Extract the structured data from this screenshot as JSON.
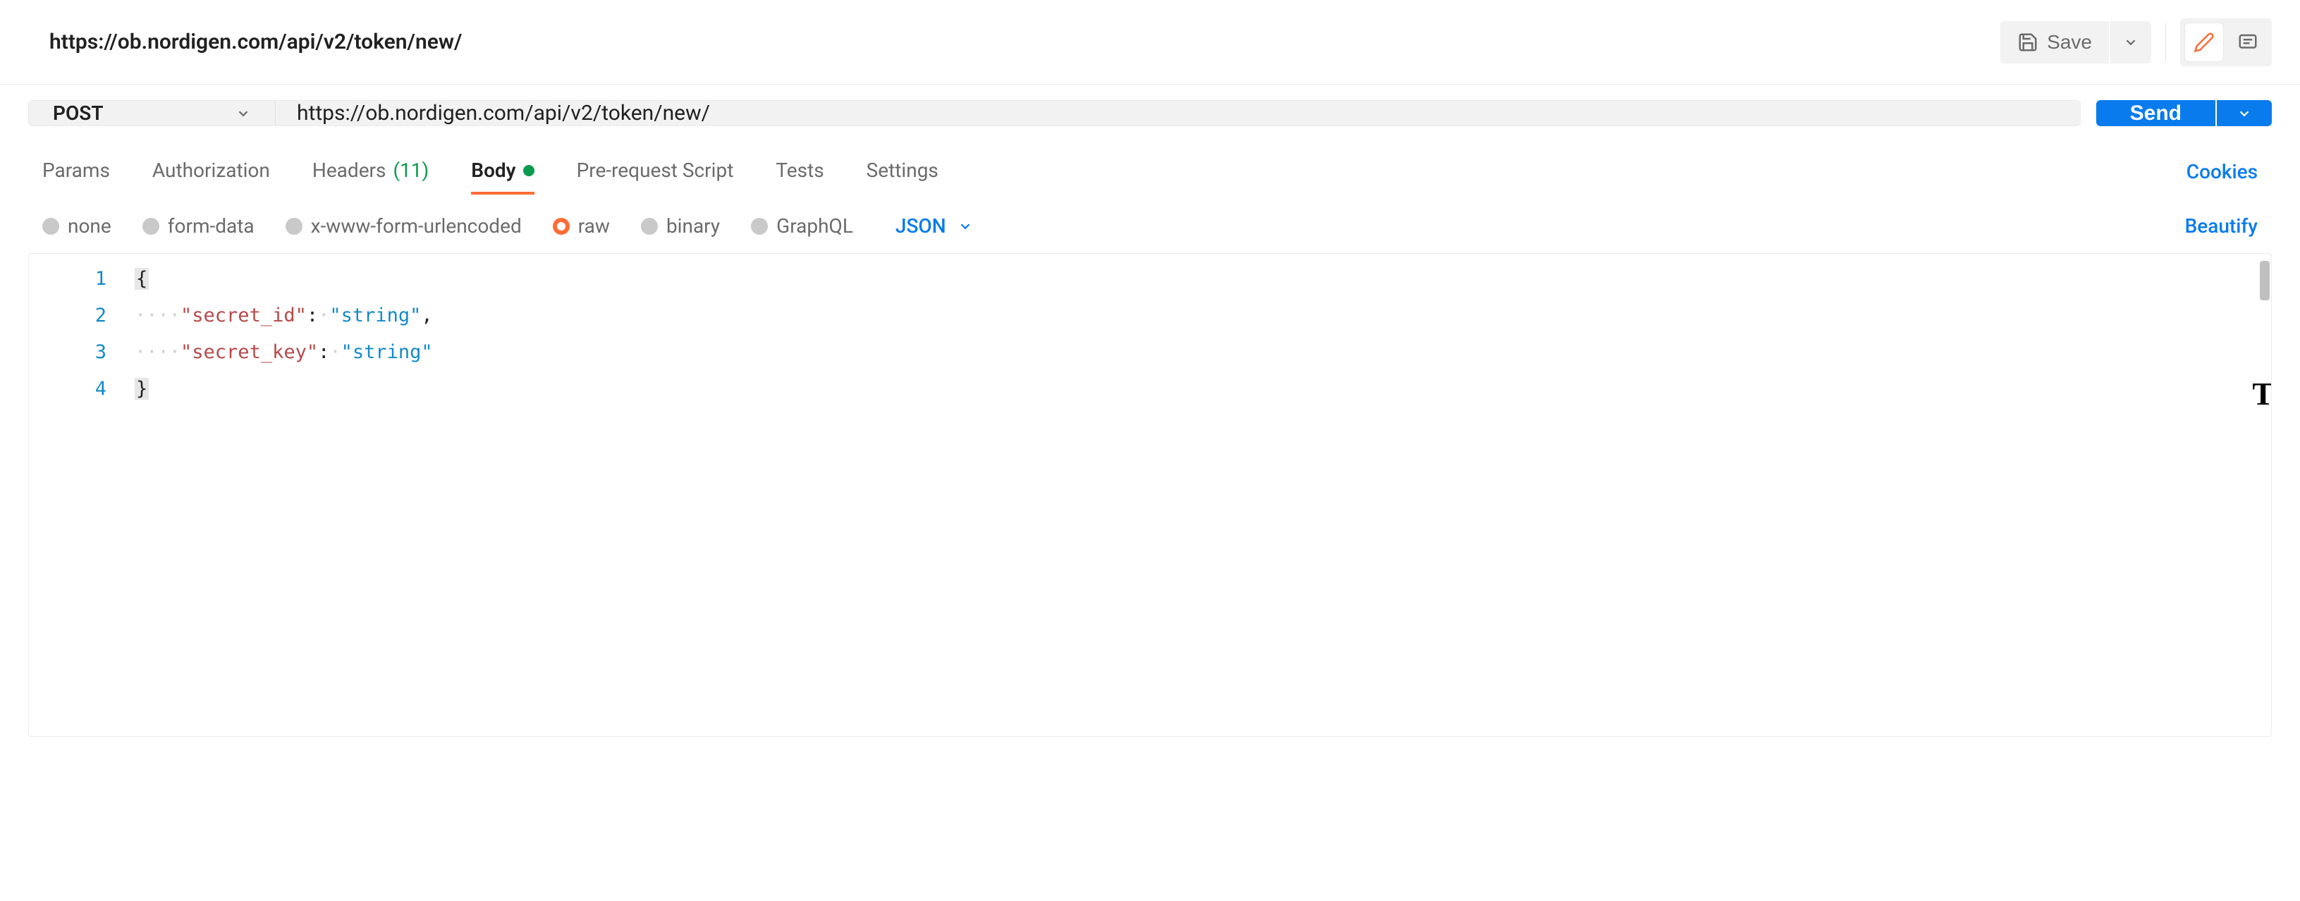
{
  "title": "https://ob.nordigen.com/api/v2/token/new/",
  "save_label": "Save",
  "request": {
    "method": "POST",
    "url": "https://ob.nordigen.com/api/v2/token/new/",
    "send_label": "Send"
  },
  "tabs": {
    "params": "Params",
    "authorization": "Authorization",
    "headers_label": "Headers",
    "headers_count": "(11)",
    "body": "Body",
    "prerequest": "Pre-request Script",
    "tests": "Tests",
    "settings": "Settings"
  },
  "cookies_label": "Cookies",
  "body_types": {
    "none": "none",
    "formdata": "form-data",
    "xwww": "x-www-form-urlencoded",
    "raw": "raw",
    "binary": "binary",
    "graphql": "GraphQL"
  },
  "lang_label": "JSON",
  "beautify_label": "Beautify",
  "editor": {
    "line_numbers": [
      "1",
      "2",
      "3",
      "4"
    ],
    "brace_open": "{",
    "brace_close": "}",
    "indent_dots": "····",
    "key1": "\"secret_id\"",
    "sep1": ":·",
    "val1": "\"string\"",
    "comma": ",",
    "key2": "\"secret_key\"",
    "sep2": ":·",
    "val2": "\"string\""
  }
}
